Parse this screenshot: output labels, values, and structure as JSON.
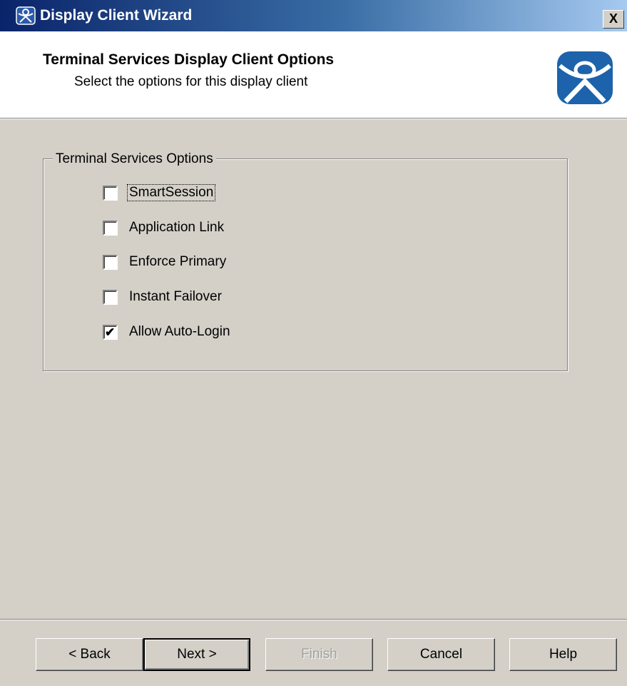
{
  "window": {
    "title": "Display Client Wizard",
    "close_label": "X"
  },
  "header": {
    "title": "Terminal Services Display Client Options",
    "subtitle": "Select the options for this display client"
  },
  "group": {
    "label": "Terminal Services Options",
    "options": [
      {
        "label": "SmartSession",
        "checked": false
      },
      {
        "label": "Application Link",
        "checked": false
      },
      {
        "label": "Enforce Primary",
        "checked": false
      },
      {
        "label": "Instant Failover",
        "checked": false
      },
      {
        "label": "Allow Auto-Login",
        "checked": true
      }
    ],
    "check_mark": "✔"
  },
  "buttons": {
    "back": "< Back",
    "next": "Next >",
    "finish": "Finish",
    "cancel": "Cancel",
    "help": "Help"
  },
  "colors": {
    "title_bar": "#0a246a",
    "dialog_bg": "#d4d0c8",
    "logo_blue": "#1c63ab"
  }
}
